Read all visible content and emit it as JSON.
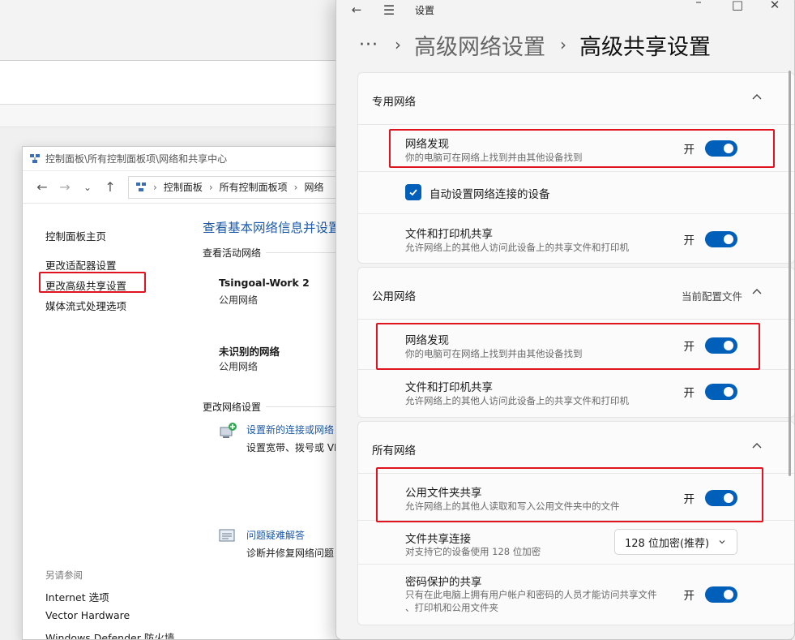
{
  "control_panel": {
    "window_title": "控制面板\\所有控制面板项\\网络和共享中心",
    "address": {
      "segments": [
        "控制面板",
        "所有控制面板项",
        "网络"
      ]
    },
    "sidebar": {
      "home_link": "控制面板主页",
      "links": [
        "更改适配器设置",
        "更改高级共享设置",
        "媒体流式处理选项"
      ],
      "see_also_label": "另请参阅",
      "see_also_links": [
        "Internet 选项",
        "Vector Hardware",
        "Windows Defender 防火墙"
      ]
    },
    "main": {
      "heading": "查看基本网络信息并设置",
      "active_networks_label": "查看活动网络",
      "networks": [
        {
          "name": "Tsingoal-Work 2",
          "type": "公用网络"
        },
        {
          "name": "未识别的网络",
          "type": "公用网络"
        }
      ],
      "change_settings_label": "更改网络设置",
      "tasks": [
        {
          "link": "设置新的连接或网络",
          "desc": "设置宽带、拨号或 VI"
        },
        {
          "link": "问题疑难解答",
          "desc": "诊断并修复网络问题"
        }
      ]
    }
  },
  "settings": {
    "app_title": "设置",
    "breadcrumb": {
      "more": "···",
      "parent": "高级网络设置",
      "current": "高级共享设置"
    },
    "sections": {
      "private": {
        "title": "专用网络",
        "network_discovery": {
          "title": "网络发现",
          "desc": "你的电脑可在网络上找到并由其他设备找到",
          "state": "开"
        },
        "auto_setup": {
          "label": "自动设置网络连接的设备",
          "checked": true
        },
        "file_printer": {
          "title": "文件和打印机共享",
          "desc": "允许网络上的其他人访问此设备上的共享文件和打印机",
          "state": "开"
        }
      },
      "public": {
        "title": "公用网络",
        "subtitle": "当前配置文件",
        "network_discovery": {
          "title": "网络发现",
          "desc": "你的电脑可在网络上找到并由其他设备找到",
          "state": "开"
        },
        "file_printer": {
          "title": "文件和打印机共享",
          "desc": "允许网络上的其他人访问此设备上的共享文件和打印机",
          "state": "开"
        }
      },
      "all": {
        "title": "所有网络",
        "public_folder": {
          "title": "公用文件夹共享",
          "desc": "允许网络上的其他人读取和写入公用文件夹中的文件",
          "state": "开"
        },
        "file_sharing_conn": {
          "title": "文件共享连接",
          "desc": "对支持它的设备使用 128 位加密",
          "selected": "128 位加密(推荐)"
        },
        "password_protect": {
          "title": "密码保护的共享",
          "desc_line1": "只有在此电脑上拥有用户帐户和密码的人员才能访问共享文件",
          "desc_line2": "、打印机和公用文件夹",
          "state": "开"
        }
      }
    }
  },
  "colors": {
    "accent": "#005fb8",
    "link": "#1e5aa8",
    "highlight_box": "#e0141e"
  }
}
